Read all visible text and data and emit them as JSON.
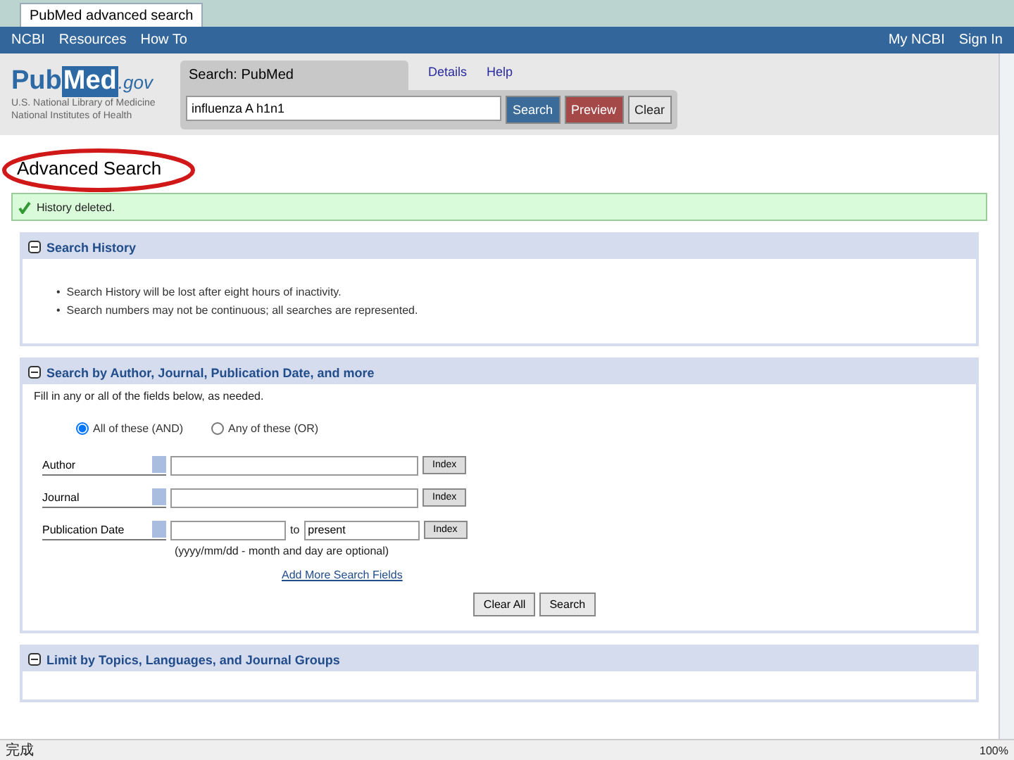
{
  "browser": {
    "tab_title": "PubMed advanced search",
    "status": "完成",
    "zoom": "100%"
  },
  "ncbi_bar": {
    "brand": "NCBI",
    "menus": [
      "Resources",
      "How To"
    ],
    "account": "My NCBI",
    "sign_in": "Sign In"
  },
  "header": {
    "logo_left": "Pub",
    "logo_mid": "Med",
    "logo_tail": ".gov",
    "affiliation": [
      "U.S. National Library of Medicine",
      "National Institutes of Health"
    ],
    "search_label": "Search: PubMed",
    "links": [
      "Details",
      "Help"
    ],
    "query": "influenza A h1n1",
    "buttons": [
      {
        "label": "Search",
        "kind": "primary"
      },
      {
        "label": "Preview",
        "kind": "danger"
      },
      {
        "label": "Clear",
        "kind": "plain"
      }
    ]
  },
  "title": "Advanced Search",
  "message": "History deleted.",
  "sections": [
    {
      "title": "Search History",
      "expanded": true,
      "kind": "history",
      "bullets": [
        "•  Search History will be lost after eight hours of inactivity.",
        "•  Search numbers may not be continuous; all searches are represented."
      ]
    },
    {
      "title": "Search by Author, Journal, Publication Date, and more",
      "expanded": true,
      "kind": "builder",
      "intro": "Fill in any or all of the fields below, as needed.",
      "options": [
        {
          "label": "All of these (AND)",
          "selected": true
        },
        {
          "label": "Any of these (OR)",
          "selected": false
        }
      ],
      "fields": [
        {
          "kind": "text",
          "field": "Author",
          "index": "Index"
        },
        {
          "kind": "text",
          "field": "Journal",
          "index": "Index"
        },
        {
          "kind": "range",
          "field": "Publication Date",
          "to": "to",
          "end": "present",
          "index": "Index",
          "hint": "(yyyy/mm/dd - month and day are optional)"
        }
      ],
      "more_link": "Add More Search Fields",
      "actions": [
        "Clear All",
        "Search"
      ]
    },
    {
      "title": "Limit by Topics, Languages, and Journal Groups",
      "expanded": true,
      "kind": "limits"
    }
  ]
}
